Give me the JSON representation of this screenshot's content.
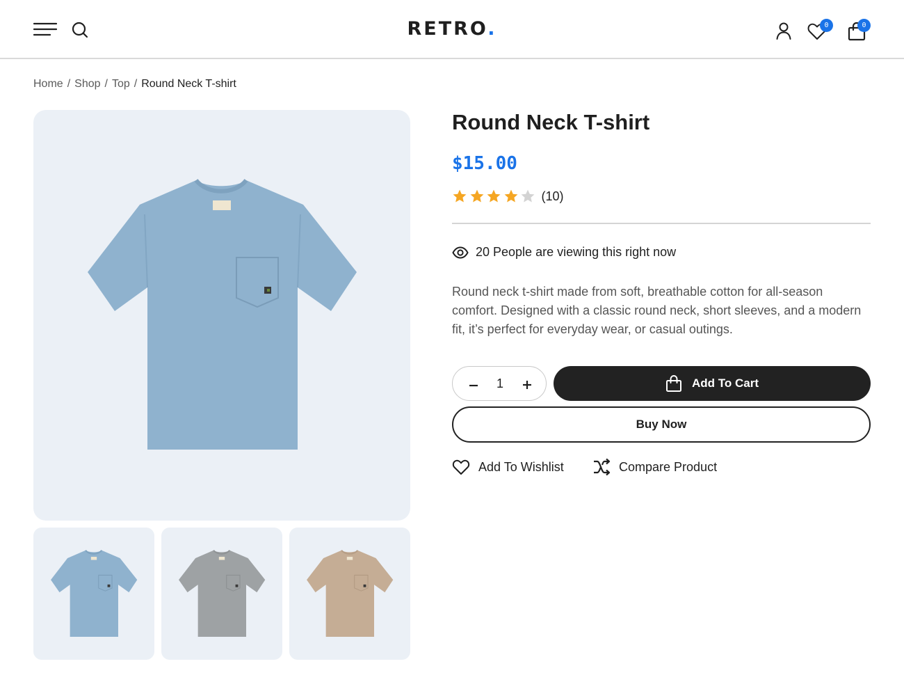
{
  "header": {
    "logo_text": "RETRO",
    "logo_dot": ".",
    "wishlist_count": "0",
    "cart_count": "0",
    "icons": [
      "menu-icon",
      "search-icon",
      "user-icon",
      "heart-icon",
      "shopping-bag-icon"
    ]
  },
  "breadcrumb": {
    "items": [
      "Home",
      "Shop",
      "Top"
    ],
    "separator": "/",
    "current": "Round Neck T-shirt"
  },
  "gallery": {
    "thumbnails": [
      {
        "color_name": "blue",
        "color": "#8fb2ce"
      },
      {
        "color_name": "grey",
        "color": "#9ea2a4"
      },
      {
        "color_name": "beige",
        "color": "#c5ad95"
      }
    ],
    "main_color": "#8fb2ce"
  },
  "product": {
    "title": "Round Neck T-shirt",
    "price": "$15.00",
    "rating": 4,
    "rating_max": 5,
    "rating_count": "(10)",
    "viewers_text": "20 People are viewing this right now",
    "description": "Round neck t-shirt made from soft, breathable cotton for all-season comfort. Designed with a classic round neck, short sleeves, and a modern fit, it’s perfect for everyday wear, or casual outings."
  },
  "purchase": {
    "quantity": "1",
    "add_to_cart_label": "Add To Cart",
    "buy_now_label": "Buy Now",
    "wishlist_label": "Add To Wishlist",
    "compare_label": "Compare Product"
  },
  "colors": {
    "accent": "#1a73e8",
    "dark_button": "#222222",
    "star_filled": "#f5a623",
    "star_empty": "#d3d3d3",
    "image_bg": "#ebf0f6"
  }
}
